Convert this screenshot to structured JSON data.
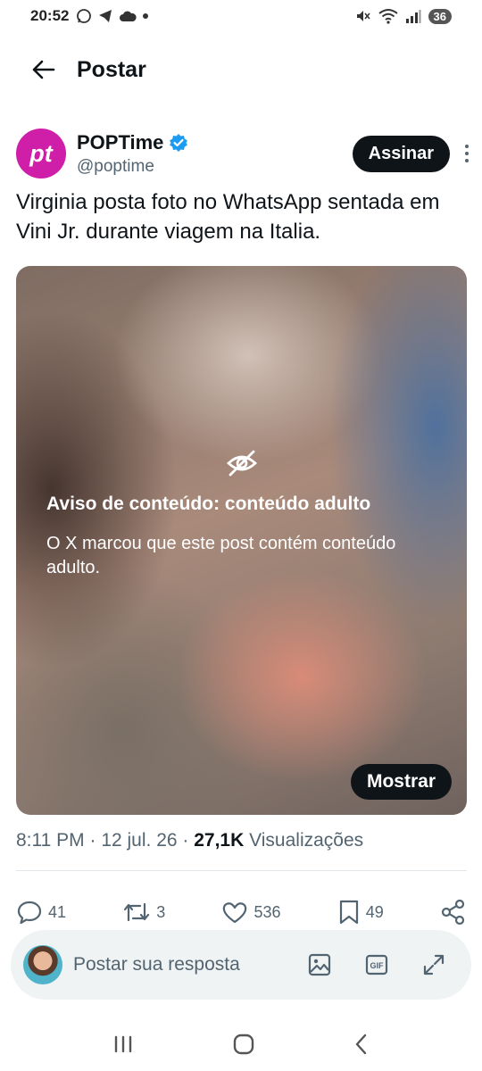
{
  "status_bar": {
    "time": "20:52",
    "battery": "36"
  },
  "header": {
    "title": "Postar"
  },
  "author": {
    "avatar_text": "pt",
    "name": "POPTime",
    "handle": "@poptime",
    "follow_label": "Assinar"
  },
  "post": {
    "text": "Virginia posta foto no WhatsApp sentada em Vini Jr. durante viagem na Italia."
  },
  "media": {
    "warning_title": "Aviso de conteúdo: conteúdo adulto",
    "warning_desc": "O X marcou que este post contém conteúdo adulto.",
    "show_label": "Mostrar"
  },
  "meta": {
    "time": "8:11 PM",
    "date": "12 jul. 26",
    "views_count": "27,1K",
    "views_label": "Visualizações"
  },
  "actions": {
    "replies": "41",
    "reposts": "3",
    "likes": "536",
    "bookmarks": "49"
  },
  "reply": {
    "placeholder": "Postar sua resposta"
  },
  "colors": {
    "accent": "#1d9bf0",
    "avatar_bg": "#cf1ea8",
    "text": "#0f1419",
    "muted": "#536471"
  }
}
